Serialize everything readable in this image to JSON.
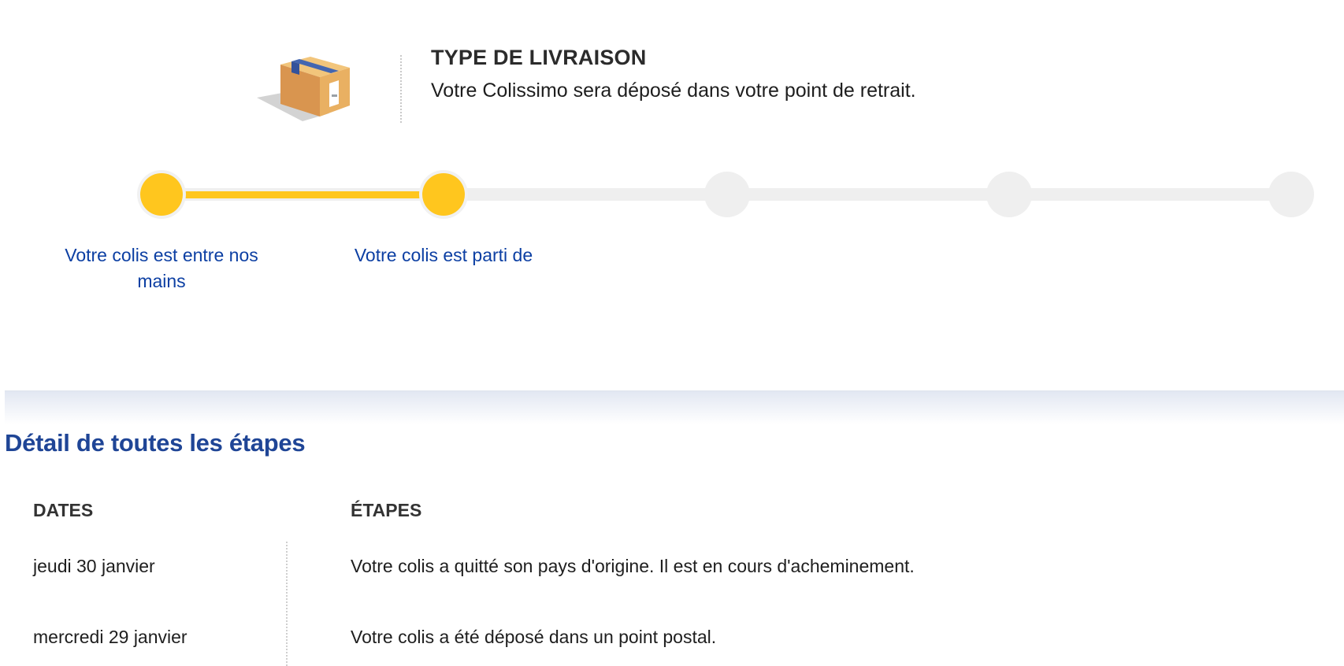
{
  "delivery": {
    "title": "TYPE DE LIVRAISON",
    "text": "Votre Colissimo sera déposé dans votre point de retrait.",
    "icon": "parcel-box-icon"
  },
  "progress": {
    "completed_steps": 2,
    "total_steps": 5,
    "accent_color": "#ffc61e",
    "inactive_color": "#efefef",
    "steps": [
      {
        "label": "Votre colis est entre nos mains",
        "done": true
      },
      {
        "label": "Votre colis est parti de",
        "done": true
      },
      {
        "label": "",
        "done": false
      },
      {
        "label": "",
        "done": false
      },
      {
        "label": "",
        "done": false
      }
    ]
  },
  "details": {
    "title": "Détail de toutes les étapes",
    "title_color": "#1f4596",
    "columns": {
      "dates": "DATES",
      "steps": "ÉTAPES"
    },
    "rows": [
      {
        "date": "jeudi 30 janvier",
        "step": "Votre colis a quitté son pays d'origine. Il est en cours d'acheminement."
      },
      {
        "date": "mercredi 29 janvier",
        "step": "Votre colis a été déposé dans un point postal."
      }
    ]
  }
}
